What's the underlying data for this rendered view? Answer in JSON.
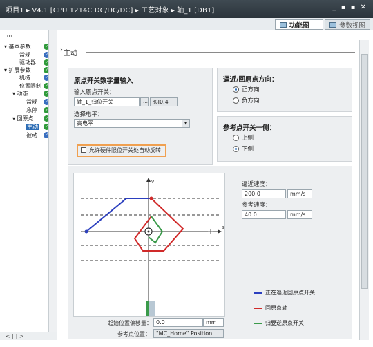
{
  "titlebar": {
    "breadcrumb": "项目1 ▸ V4.1 [CPU 1214C DC/DC/DC] ▸ 工艺对象 ▸ 轴_1 [DB1]",
    "window_controls": "_ ▪ ▪ ✕"
  },
  "viewbar": {
    "function_view": "功能图",
    "param_view": "参数视图"
  },
  "sidebar": {
    "top_icon": "ꝏ",
    "items": [
      {
        "label": "▾ 基本参数",
        "status": "green"
      },
      {
        "label": "常规",
        "status": "blue"
      },
      {
        "label": "驱动器",
        "status": "green"
      },
      {
        "label": "▾ 扩展参数",
        "status": "green"
      },
      {
        "label": "机械",
        "status": "blue"
      },
      {
        "label": "位置限制",
        "status": "green"
      },
      {
        "label": "▾ 动态",
        "status": "green"
      },
      {
        "label": "常规",
        "status": "blue"
      },
      {
        "label": "急停",
        "status": "green"
      },
      {
        "label": "▾ 回原点",
        "status": "green"
      },
      {
        "label": "主动",
        "status": "green",
        "selected": true
      },
      {
        "label": "被动",
        "status": "blue"
      }
    ],
    "hscroll": "<  |||  >"
  },
  "content": {
    "section_title": "主动",
    "arrow": "›",
    "home_switch": {
      "title": "原点开关数字量输入",
      "input_label": "输入原点开关：",
      "input_value": "轴_1_归位开关",
      "input_address": "%I0.4",
      "level_label": "选择电平：",
      "level_value": "高电平",
      "checkbox_label": "允许硬件限位开关处自动反转"
    },
    "direction": {
      "title": "逼近/回原点方向：",
      "opt_positive": "正方向",
      "opt_negative": "负方向"
    },
    "ref_side": {
      "title": "参考点开关一侧：",
      "opt_upper": "上侧",
      "opt_lower": "下侧"
    },
    "speeds": {
      "approach_label": "逼近速度：",
      "approach_value": "200.0",
      "approach_unit": "mm/s",
      "ref_label": "参考速度：",
      "ref_value": "40.0",
      "ref_unit": "mm/s"
    },
    "offset": {
      "label": "起始位置偏移量：",
      "value": "0.0",
      "unit": "mm"
    },
    "refpos": {
      "label": "参考点位置：",
      "value": "\"MC_Home\".Position"
    },
    "legend": {
      "blue": "正在逼近回原点开关",
      "red": "回原点轴",
      "green": "归要逆原点开关"
    },
    "chart_axes": {
      "v": "v",
      "s": "s"
    }
  },
  "colors": {
    "blue": "#2b3fbf",
    "red": "#d02a2a",
    "green": "#3a9a4a",
    "accent": "#f0a050"
  }
}
